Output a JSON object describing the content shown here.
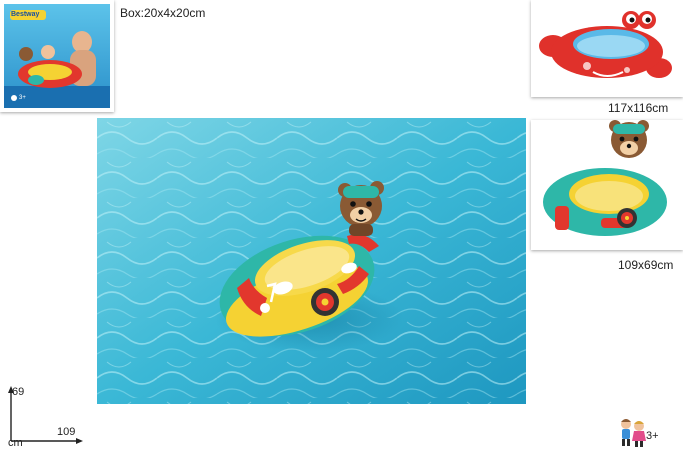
{
  "product": {
    "box_size": "Box:20x4x20cm",
    "brand_logo_text": "Bestway",
    "package_age_mark": "3+"
  },
  "variants": [
    {
      "name": "crab-boat",
      "size": "117x116cm"
    },
    {
      "name": "bear-boat",
      "size": "109x69cm"
    }
  ],
  "dimension_marker": {
    "height": "69",
    "width": "109",
    "unit": "cm"
  },
  "age_recommendation": "3+",
  "colors": {
    "water_light": "#7fd6e6",
    "water_mid": "#3bb8d6",
    "water_deep": "#1e97c0",
    "float_teal": "#2eb7a8",
    "float_yellow": "#f5d233",
    "float_red": "#e2372d",
    "bear_brown": "#8a5a34",
    "crab_red": "#e0312b",
    "pool_blue": "#5ab9e8"
  }
}
